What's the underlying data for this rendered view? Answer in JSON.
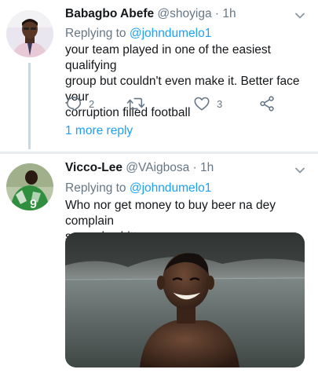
{
  "tweets": [
    {
      "author_name": "Babagbo Abefe",
      "handle": "@shoyiga",
      "separator": "·",
      "time": "1h",
      "replying_prefix": "Replying to",
      "replying_to": "@johndumelo1",
      "text_lines": [
        "your team played in one of the easiest qualifying",
        "group but couldn't even make it.  Better face your",
        "corruption filled football"
      ],
      "reply_count": "2",
      "like_count": "3",
      "more_replies": "1 more reply",
      "icons": [
        "reply-icon",
        "retweet-icon",
        "like-icon",
        "share-icon",
        "chevron-down-icon"
      ]
    },
    {
      "author_name": "Vicco-Lee",
      "handle": "@VAigbosa",
      "separator": "·",
      "time": "1h",
      "replying_prefix": "Replying to",
      "replying_to": "@johndumelo1",
      "text_lines": [
        "Who nor get money to buy beer na dey complain",
        "say e dey bitter"
      ],
      "jersey_number": "9",
      "icons": [
        "chevron-down-icon"
      ]
    }
  ],
  "colors": {
    "accent": "#1da1f2",
    "secondary_text": "#657786",
    "primary_text": "#14171a",
    "divider": "#e6ecf0"
  }
}
